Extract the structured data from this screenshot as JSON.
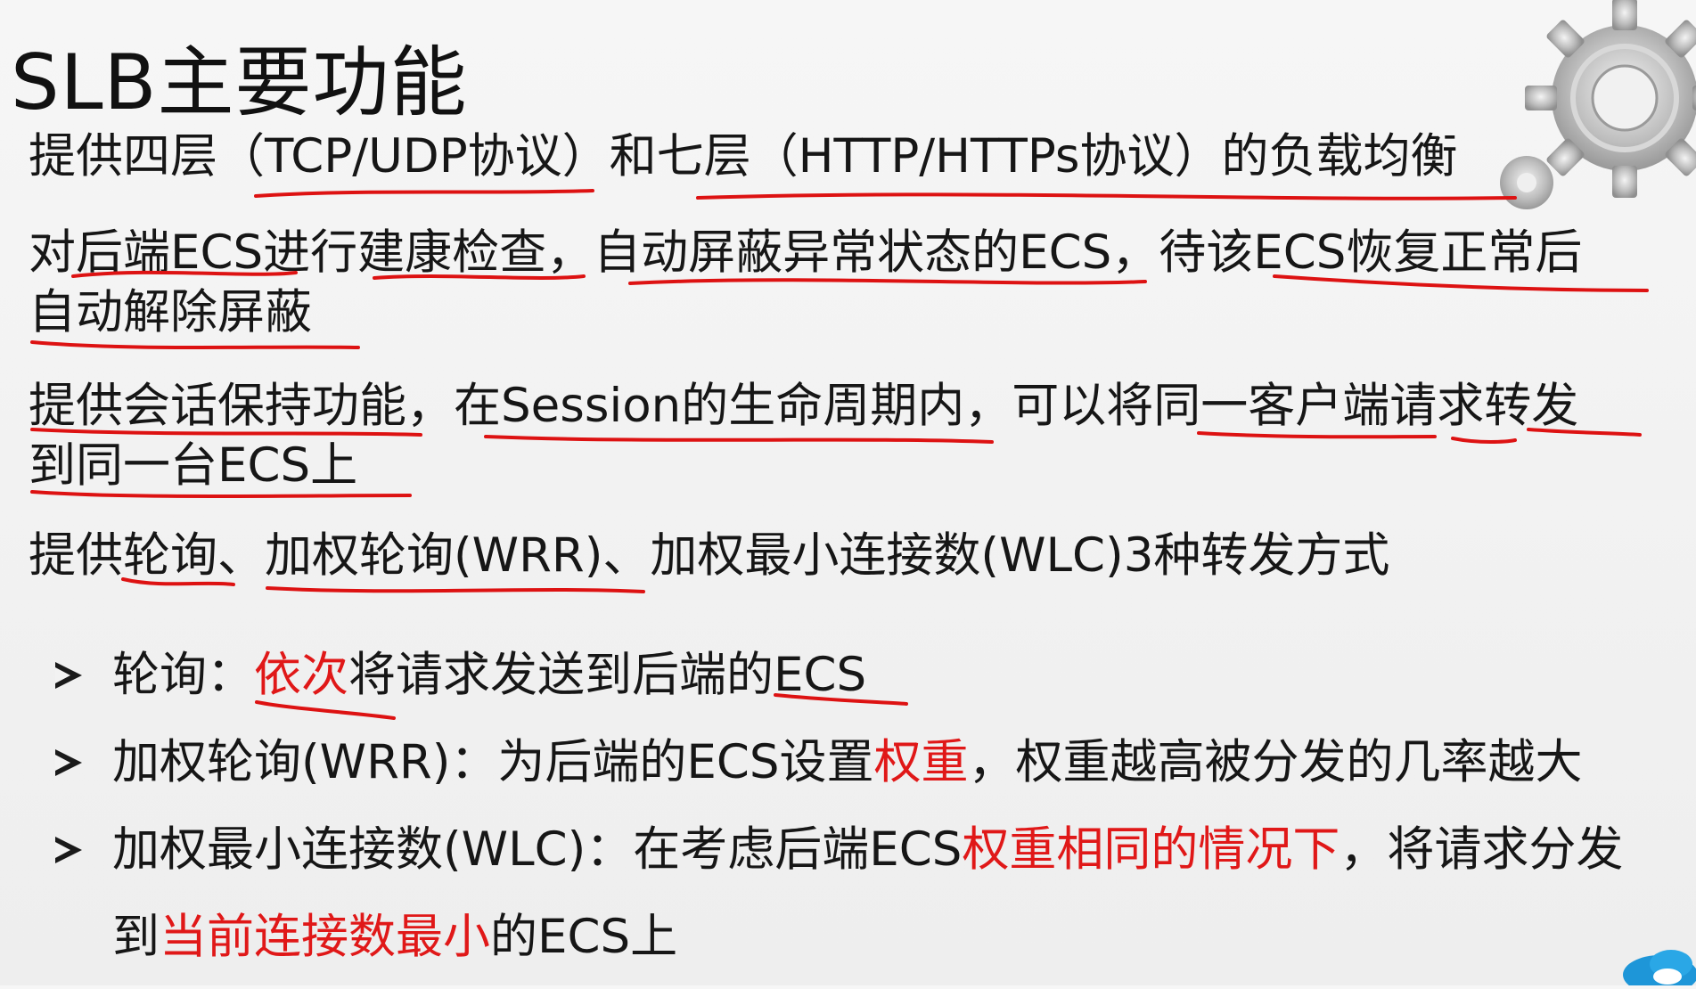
{
  "slide": {
    "title": "SLB主要功能",
    "lines": [
      {
        "text": "提供四层（TCP/UDP协议）和七层（HTTP/HTTPs协议）的负载均衡"
      },
      {
        "text": "对后端ECS进行建康检查，自动屏蔽异常状态的ECS，待该ECS恢复正常后"
      },
      {
        "text": "自动解除屏蔽"
      },
      {
        "text": "提供会话保持功能，在Session的生命周期内，可以将同一客户端请求转发"
      },
      {
        "text": "到同一台ECS上"
      },
      {
        "text": "提供轮询、加权轮询(WRR)、加权最小连接数(WLC)3种转发方式"
      }
    ],
    "bullets": [
      {
        "pre": "轮询：",
        "red": "依次",
        "post": "将请求发送到后端的ECS"
      },
      {
        "pre": "加权轮询(WRR)：为后端的ECS设置",
        "red": "权重",
        "post": "，权重越高被分发的几率越大"
      },
      {
        "pre": "加权最小连接数(WLC)：在考虑后端ECS",
        "red": "权重相同的情况下",
        "post": "，将请求分发"
      }
    ],
    "continuation": {
      "pre": "到",
      "red": "当前连接数最小",
      "post": "的ECS上"
    },
    "colors": {
      "emphasis": "#e01818",
      "annotation": "#dd1212",
      "text": "#161616"
    },
    "icons": [
      "gear-decoration-icon",
      "cloud-logo-icon",
      "bullet-arrow-icon"
    ]
  }
}
